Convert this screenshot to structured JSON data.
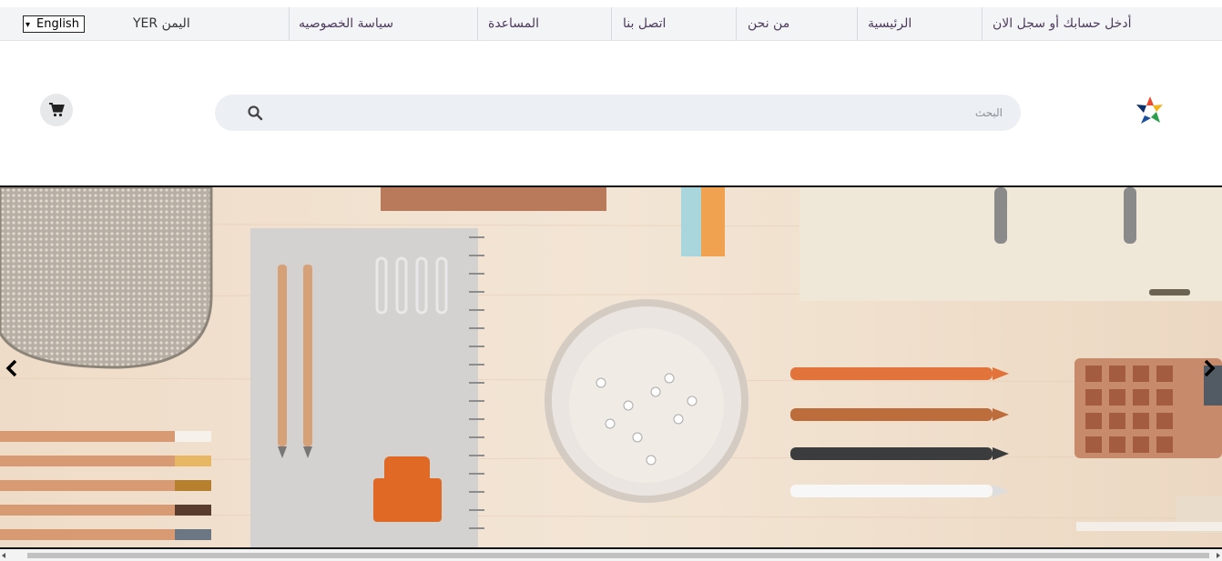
{
  "topbar": {
    "language_select": "English",
    "currency": "اليمن YER",
    "items": [
      {
        "label": "سياسة الخصوصيه"
      },
      {
        "label": "المساعدة"
      },
      {
        "label": "اتصل بنا"
      },
      {
        "label": "من نحن"
      },
      {
        "label": "الرئيسية"
      },
      {
        "label": "أدخل حسابك أو سجل الان"
      }
    ]
  },
  "header": {
    "search_placeholder": "البحث",
    "logo": "store-logo",
    "cart_icon": "cart-icon"
  },
  "hero": {
    "image": "stationery-flatlay",
    "prev_icon": "chevron-left-icon",
    "next_icon": "chevron-right-icon"
  },
  "colors": {
    "nav_text": "#4e3a5c",
    "topbar_bg": "#f2f4f6",
    "search_bg": "#eceff3"
  }
}
